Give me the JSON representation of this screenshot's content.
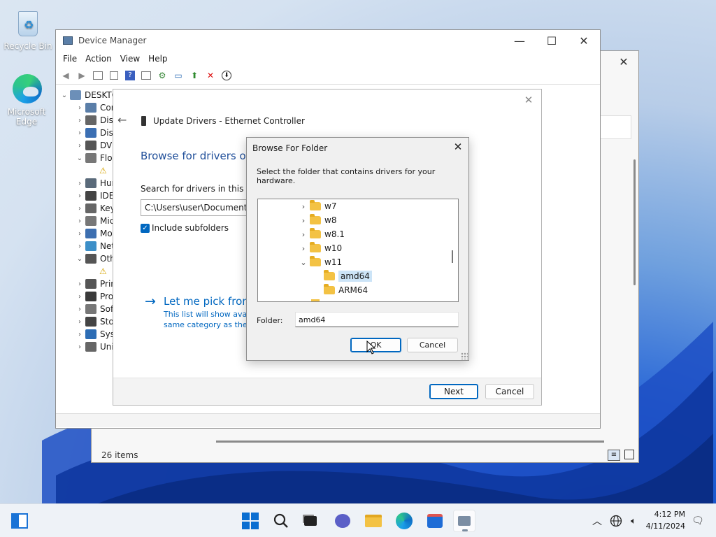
{
  "desktop": {
    "icons": [
      {
        "label": "Recycle Bin",
        "icon": "recycle-bin-icon"
      },
      {
        "label": "Microsoft Edge",
        "icon": "edge-icon"
      }
    ]
  },
  "explorer": {
    "status": "26 items"
  },
  "device_manager": {
    "title": "Device Manager",
    "menu": [
      "File",
      "Action",
      "View",
      "Help"
    ],
    "tree_root": "DESKTO",
    "tree": [
      {
        "label": "Cor",
        "expanded": false
      },
      {
        "label": "Disk",
        "expanded": false
      },
      {
        "label": "Disp",
        "expanded": false
      },
      {
        "label": "DVD",
        "expanded": false
      },
      {
        "label": "Flop",
        "expanded": true
      },
      {
        "label": "",
        "child": true
      },
      {
        "label": "Hum",
        "expanded": false
      },
      {
        "label": "IDE",
        "expanded": false
      },
      {
        "label": "Key",
        "expanded": false
      },
      {
        "label": "Mic",
        "expanded": false
      },
      {
        "label": "Mo",
        "expanded": false
      },
      {
        "label": "Net",
        "expanded": false
      },
      {
        "label": "Oth",
        "expanded": true
      },
      {
        "label": "",
        "child": true
      },
      {
        "label": "Prin",
        "expanded": false
      },
      {
        "label": "Pro",
        "expanded": false
      },
      {
        "label": "Soft",
        "expanded": false
      },
      {
        "label": "Stor",
        "expanded": false
      },
      {
        "label": "Syst",
        "expanded": false
      },
      {
        "label": "Univ",
        "expanded": false
      }
    ]
  },
  "update_drivers": {
    "header": "Update Drivers - Ethernet Controller",
    "heading": "Browse for drivers on",
    "search_label": "Search for drivers in this locat",
    "path_value": "C:\\Users\\user\\Documents",
    "include_subfolders": "Include subfolders",
    "pick_link": "Let me pick from",
    "pick_desc_1": "This list will show avail",
    "pick_desc_2": "same category as the d",
    "next": "Next",
    "cancel": "Cancel"
  },
  "browse_dialog": {
    "title": "Browse For Folder",
    "instruction": "Select the folder that contains drivers for your hardware.",
    "folders": [
      {
        "label": "w7",
        "level": 0,
        "chevron": "right"
      },
      {
        "label": "w8",
        "level": 0,
        "chevron": "right"
      },
      {
        "label": "w8.1",
        "level": 0,
        "chevron": "right"
      },
      {
        "label": "w10",
        "level": 0,
        "chevron": "right"
      },
      {
        "label": "w11",
        "level": 0,
        "chevron": "down"
      },
      {
        "label": "amd64",
        "level": 1,
        "selected": true
      },
      {
        "label": "ARM64",
        "level": 1
      }
    ],
    "folder_label": "Folder:",
    "folder_value": "amd64",
    "ok": "OK",
    "cancel": "Cancel"
  },
  "taskbar": {
    "time": "4:12 PM",
    "date": "4/11/2024"
  }
}
